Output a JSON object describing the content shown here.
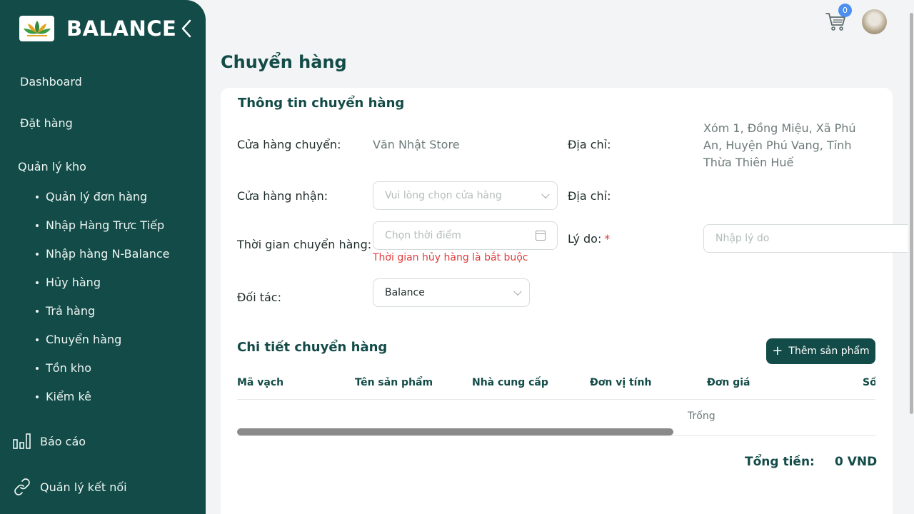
{
  "brand": {
    "name": "BALANCE"
  },
  "sidebar": {
    "items": [
      {
        "label": "Dashboard"
      },
      {
        "label": "Đặt hàng"
      },
      {
        "label": "Quản lý kho"
      }
    ],
    "subitems": [
      {
        "label": "Quản lý đơn hàng"
      },
      {
        "label": "Nhập Hàng Trực Tiếp"
      },
      {
        "label": "Nhập hàng N-Balance"
      },
      {
        "label": "Hủy hàng"
      },
      {
        "label": "Trả hàng"
      },
      {
        "label": "Chuyển hàng"
      },
      {
        "label": "Tồn kho"
      },
      {
        "label": "Kiểm kê"
      }
    ],
    "bottom": [
      {
        "label": "Báo cáo",
        "icon": "bar-chart-icon"
      },
      {
        "label": "Quản lý kết nối",
        "icon": "link-icon"
      }
    ]
  },
  "header": {
    "cart_count": "0"
  },
  "page": {
    "title": "Chuyển hàng"
  },
  "info": {
    "title": "Thông tin chuyển hàng",
    "from_store_label": "Cửa hàng chuyển:",
    "from_store_value": "Văn Nhật Store",
    "address_label": "Địa chỉ:",
    "address_value": "Xóm 1, Đồng Miệu, Xã Phú An, Huyện Phú Vang, Tỉnh Thừa Thiên Huế",
    "to_store_label": "Cửa hàng nhận:",
    "to_store_placeholder": "Vui lòng chọn cửa hàng",
    "to_address_label": "Địa chỉ:",
    "time_label": "Thời gian chuyển hàng:",
    "time_placeholder": "Chọn thời điểm",
    "time_error": "Thời gian hủy hàng là bắt buộc",
    "reason_label": "Lý do:",
    "reason_required": "*",
    "reason_placeholder": "Nhập lý do",
    "partner_label": "Đối tác:",
    "partner_value": "Balance"
  },
  "detail": {
    "title": "Chi tiết chuyển hàng",
    "add_button": "Thêm sản phẩm",
    "columns": [
      "Mã vạch",
      "Tên sản phẩm",
      "Nhà cung cấp",
      "Đơn vị tính",
      "Đơn giá",
      "Số"
    ],
    "empty_text": "Trống",
    "total_label": "Tổng tiền:",
    "total_value": "0 VND"
  },
  "colors": {
    "primary": "#124b47",
    "error": "#e23b3b",
    "badge": "#4c8ff0"
  }
}
